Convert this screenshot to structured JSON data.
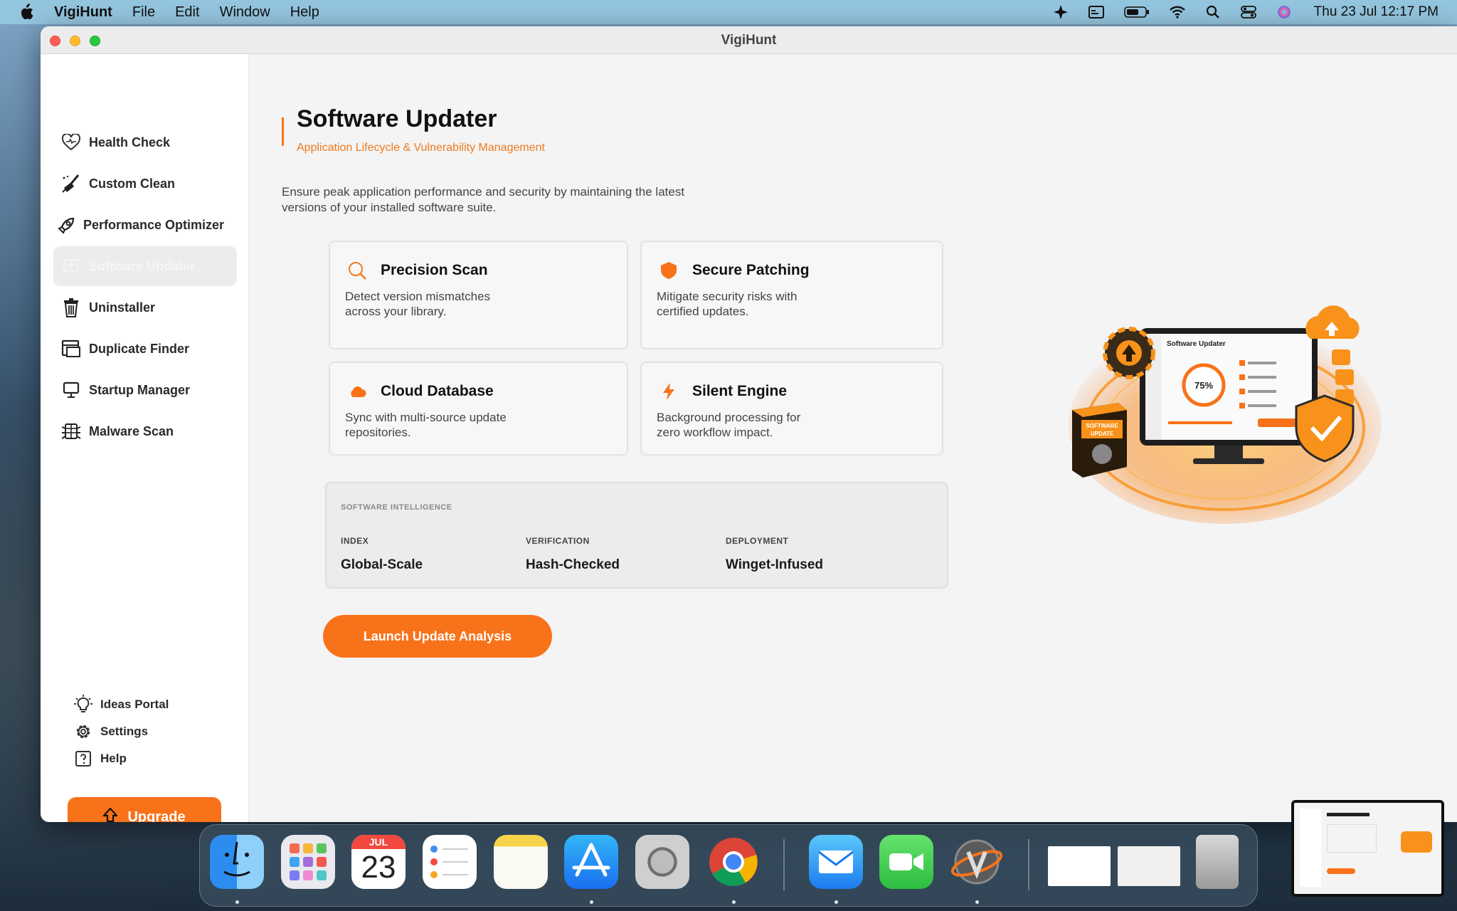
{
  "menubar": {
    "app_name": "VigiHunt",
    "items": [
      "File",
      "Edit",
      "Window",
      "Help"
    ],
    "clock": "Thu 23 Jul  12:17 PM"
  },
  "window": {
    "title": "VigiHunt"
  },
  "sidebar": {
    "items": [
      {
        "label": "Health Check",
        "icon": "heart-icon"
      },
      {
        "label": "Custom Clean",
        "icon": "broom-icon"
      },
      {
        "label": "Performance Optimizer",
        "icon": "rocket-icon"
      },
      {
        "label": "Software Updater",
        "icon": "updater-icon",
        "active": true
      },
      {
        "label": "Uninstaller",
        "icon": "trash-icon"
      },
      {
        "label": "Duplicate Finder",
        "icon": "duplicate-icon"
      },
      {
        "label": "Startup Manager",
        "icon": "monitor-icon"
      },
      {
        "label": "Malware Scan",
        "icon": "bug-icon"
      }
    ],
    "bottom": [
      {
        "label": "Ideas Portal",
        "icon": "lightbulb-icon"
      },
      {
        "label": "Settings",
        "icon": "gear-icon"
      },
      {
        "label": "Help",
        "icon": "question-icon"
      }
    ],
    "upgrade_label": "Upgrade"
  },
  "main": {
    "title": "Software Updater",
    "subtitle": "Application Lifecycle & Vulnerability Management",
    "description": "Ensure peak application performance and security by maintaining the latest versions of your installed software suite.",
    "cards": [
      {
        "title": "Precision Scan",
        "desc": "Detect version mismatches across your library.",
        "icon": "magnifier-icon"
      },
      {
        "title": "Secure Patching",
        "desc": "Mitigate security risks with certified updates.",
        "icon": "shield-icon"
      },
      {
        "title": "Cloud Database",
        "desc": "Sync with multi-source update repositories.",
        "icon": "cloud-icon"
      },
      {
        "title": "Silent Engine",
        "desc": "Background processing for zero workflow impact.",
        "icon": "bolt-icon"
      }
    ],
    "intel": {
      "heading": "SOFTWARE INTELLIGENCE",
      "columns": [
        {
          "label": "INDEX",
          "value": "Global-Scale"
        },
        {
          "label": "VERIFICATION",
          "value": "Hash-Checked"
        },
        {
          "label": "DEPLOYMENT",
          "value": "Winget-Infused"
        }
      ]
    },
    "launch_label": "Launch Update Analysis"
  },
  "hero": {
    "screen_title": "Software Updater",
    "percent": "75%",
    "box_label_line1": "SOFTWARE",
    "box_label_line2": "UPDATE"
  },
  "dock": {
    "calendar_month": "JUL",
    "calendar_day": "23"
  },
  "colors": {
    "accent": "#f8721a",
    "active_nav_bg": "#ececec"
  }
}
